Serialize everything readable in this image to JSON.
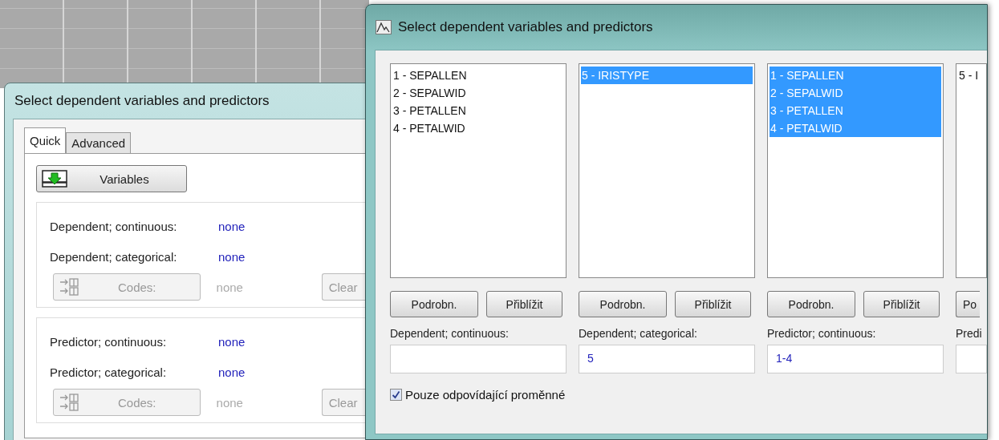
{
  "back_dialog": {
    "title": "Select dependent variables and predictors",
    "tabs": [
      {
        "label": "Quick",
        "selected": true
      },
      {
        "label": "Advanced",
        "selected": false
      }
    ],
    "variables_button": "Variables",
    "groups": [
      {
        "rows": [
          {
            "label": "Dependent; continuous:",
            "value": "none"
          },
          {
            "label": "Dependent; categorical:",
            "value": "none"
          }
        ],
        "codes_button": {
          "label": "Codes:",
          "disabled": true
        },
        "codes_value": "none",
        "clear_button": {
          "label": "Clear",
          "disabled": true
        }
      },
      {
        "rows": [
          {
            "label": "Predictor; continuous:",
            "value": "none"
          },
          {
            "label": "Predictor; categorical:",
            "value": "none"
          }
        ],
        "codes_button": {
          "label": "Codes:",
          "disabled": true
        },
        "codes_value": "none",
        "clear_button": {
          "label": "Clear",
          "disabled": true
        }
      }
    ]
  },
  "front_dialog": {
    "title": "Select dependent variables and predictors",
    "columns": [
      {
        "items": [
          {
            "text": "1 - SEPALLEN",
            "selected": false
          },
          {
            "text": "2 - SEPALWID",
            "selected": false
          },
          {
            "text": "3 - PETALLEN",
            "selected": false
          },
          {
            "text": "4 - PETALWID",
            "selected": false
          }
        ],
        "details_button": "Podrobn.",
        "zoom_button": "Přiblížit",
        "label": "Dependent; continuous:"
      },
      {
        "items": [
          {
            "text": "5 - IRISTYPE",
            "selected": true
          }
        ],
        "details_button": "Podrobn.",
        "zoom_button": "Přiblížit",
        "label": "Dependent; categorical:",
        "value": "5"
      },
      {
        "items": [
          {
            "text": "1 - SEPALLEN",
            "selected": true
          },
          {
            "text": "2 - SEPALWID",
            "selected": true
          },
          {
            "text": "3 - PETALLEN",
            "selected": true
          },
          {
            "text": "4 - PETALWID",
            "selected": true
          }
        ],
        "details_button": "Podrobn.",
        "zoom_button": "Přiblížit",
        "label": "Predictor; continuous:",
        "value": "1-4"
      },
      {
        "items": [
          {
            "text": "5 - I",
            "selected": false
          }
        ],
        "details_button": "Po",
        "label": "Predi"
      }
    ],
    "checkbox": {
      "label": "Pouze odpovídající proměnné",
      "checked": true
    }
  }
}
